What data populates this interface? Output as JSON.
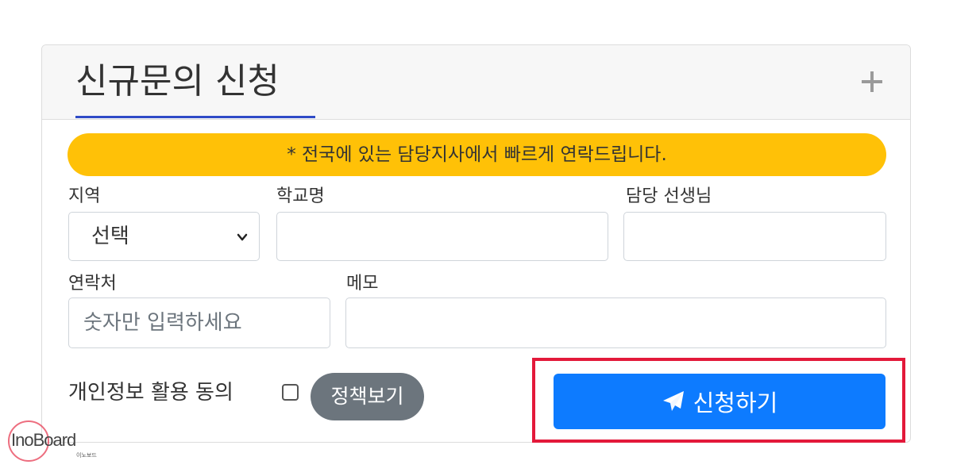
{
  "header": {
    "title": "신규문의 신청"
  },
  "notice": {
    "text": "* 전국에 있는 담당지사에서 빠르게 연락드립니다."
  },
  "form": {
    "region": {
      "label": "지역",
      "value": "선택"
    },
    "school": {
      "label": "학교명",
      "value": ""
    },
    "teacher": {
      "label": "담당 선생님",
      "value": ""
    },
    "phone": {
      "label": "연락처",
      "placeholder": "숫자만 입력하세요"
    },
    "memo": {
      "label": "메모",
      "value": ""
    },
    "consent": {
      "label": "개인정보 활용 동의",
      "checked": false
    },
    "policy_button": "정책보기",
    "submit_button": "신청하기"
  },
  "icons": {
    "expand": "plus-icon",
    "select": "chevron-down-icon",
    "submit": "paper-plane-icon"
  },
  "colors": {
    "notice_bg": "#ffc107",
    "submit_bg": "#0d7bff",
    "policy_bg": "#6c757d",
    "tab_underline": "#2f4bc7",
    "highlight_border": "#e3193a"
  },
  "watermark": {
    "text": "InoBoard",
    "subtext": "이노보드"
  }
}
